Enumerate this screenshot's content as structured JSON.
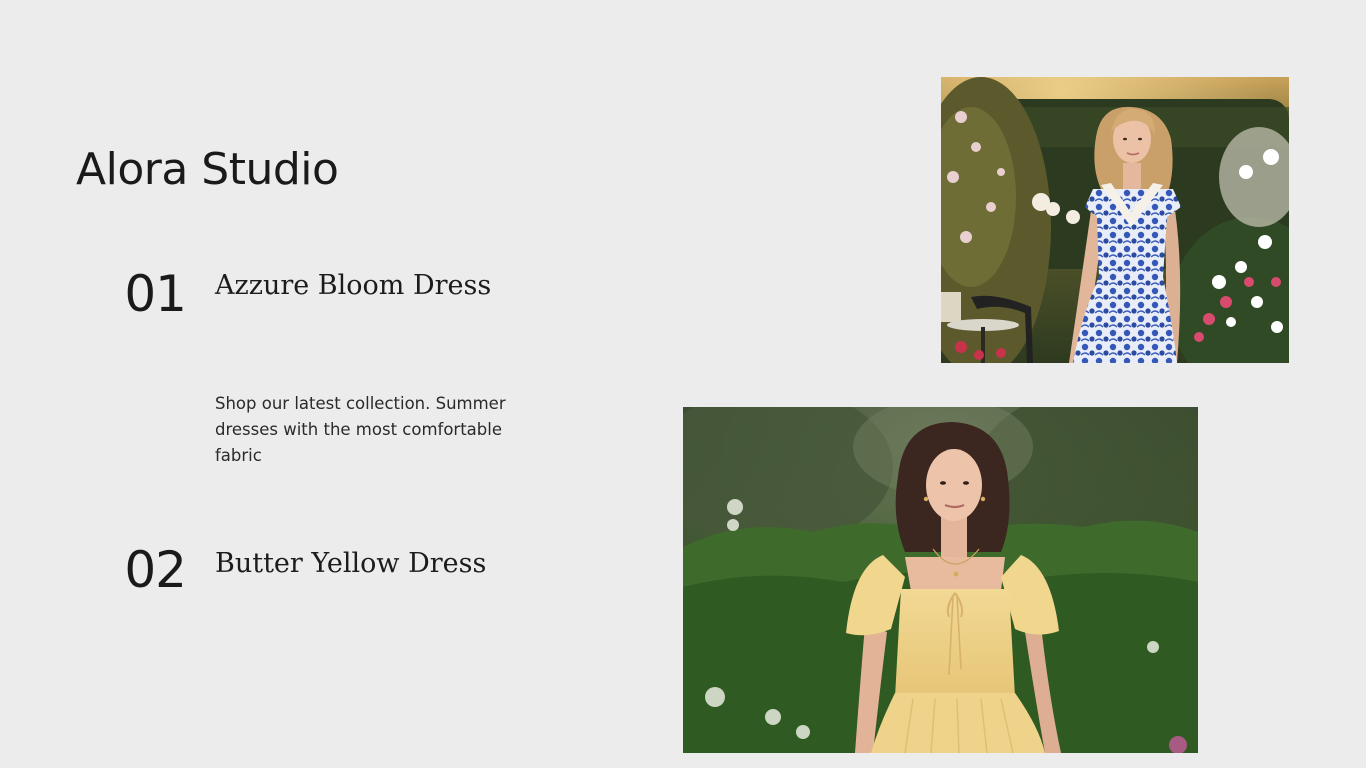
{
  "brand": {
    "name": "Alora Studio"
  },
  "products": [
    {
      "number": "01",
      "title": "Azzure Bloom Dress",
      "description": "Shop our latest collection. Summer dresses with the most comfortable fabric",
      "image": {
        "subject": "woman in blue floral dress in a rose garden",
        "accent": "#3a5fb8"
      }
    },
    {
      "number": "02",
      "title": "Butter Yellow Dress",
      "image": {
        "subject": "woman in butter yellow dress against green hedge",
        "accent": "#ecd28a"
      }
    }
  ],
  "colors": {
    "background": "#ececec",
    "text": "#1a1a1a"
  }
}
